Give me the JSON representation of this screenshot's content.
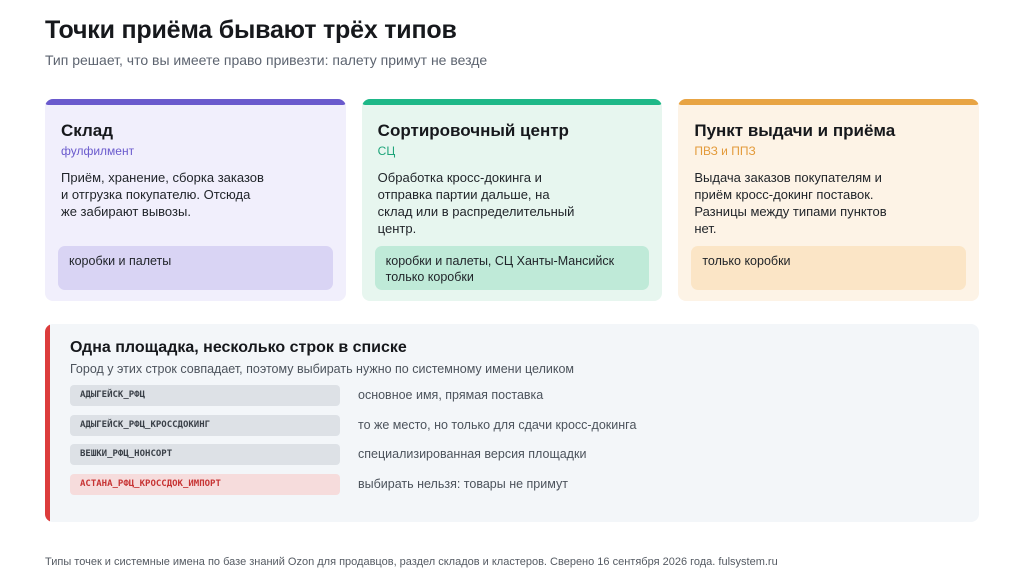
{
  "header": {
    "title": "Точки приёма бывают трёх типов",
    "subtitle": "Тип решает, что вы имеете право привезти: палету примут не везде"
  },
  "cards": [
    {
      "title": "Склад",
      "tag": "фулфилмент",
      "description": "Приём, хранение, сборка заказов и отгрузка покупателю. Отсюда же забирают вывозы.",
      "note": "коробки и палеты",
      "accent_color": "#6a5acd"
    },
    {
      "title": "Сортировочный центр",
      "tag": "СЦ",
      "description": "Обработка кросс-докинга и отправка партии дальше, на склад или в распределительный центр.",
      "note": "коробки и палеты, СЦ Ханты-Мансийск только коробки",
      "accent_color": "#1eb888"
    },
    {
      "title": "Пункт выдачи и приёма",
      "tag": "ПВЗ и ППЗ",
      "description": "Выдача заказов покупателям и приём кросс-докинг поставок. Разницы между типами пунктов нет.",
      "note": "только коробки",
      "accent_color": "#e8a444"
    }
  ],
  "panel": {
    "title": "Одна площадка, несколько строк в списке",
    "subtitle": "Город у этих строк совпадает, поэтому выбирать нужно по системному имени целиком",
    "accent_color": "#dc3c3c",
    "rows": [
      {
        "code": "АДЫГЕЙСК_РФЦ",
        "explanation": "основное имя, прямая поставка"
      },
      {
        "code": "АДЫГЕЙСК_РФЦ_КРОССДОКИНГ",
        "explanation": "то же место, но только для сдачи кросс-докинга"
      },
      {
        "code": "ВЕШКИ_РФЦ_НОНСОРТ",
        "explanation": "специализированная версия площадки"
      },
      {
        "code": "АСТАНА_РФЦ_КРОССДОК_ИМПОРТ",
        "explanation": "выбирать нельзя: товары не примут"
      }
    ]
  },
  "footer": {
    "text": "Типы точек и системные имена по базе знаний Ozon для продавцов, раздел складов и кластеров. Сверено 16 сентября 2026 года. fulsystem.ru"
  }
}
